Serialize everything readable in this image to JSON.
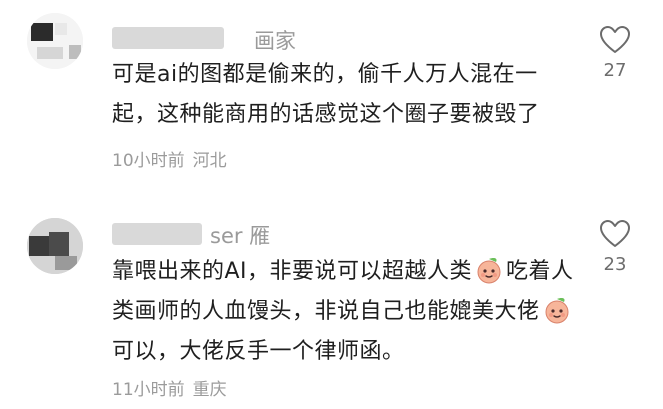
{
  "comments": [
    {
      "nickname": "画家",
      "text": "可是ai的图都是偷来的，偷千人万人混在一起，这种能商用的话感觉这个圈子要被毁了",
      "time": "10小时前",
      "location": "河北",
      "likes": "27"
    },
    {
      "nickname": "ser 雁",
      "text_part1": "靠喂出来的AI，非要说可以超越人类",
      "text_part2": "吃着人类画师的人血馒头，非说自己也能媲美大佬",
      "text_part3": "可以，大佬反手一个律师函。",
      "time": "11小时前",
      "location": "重庆",
      "likes": "23"
    }
  ],
  "icons": {
    "like": "heart-outline-icon",
    "emoji": "peach-face-emoji"
  },
  "colors": {
    "text": "#1f1f1f",
    "meta": "#9b9b9b",
    "like_count": "#6d6d6d",
    "emoji_fill": "#f7b59a",
    "emoji_leaf": "#6bbf59"
  }
}
